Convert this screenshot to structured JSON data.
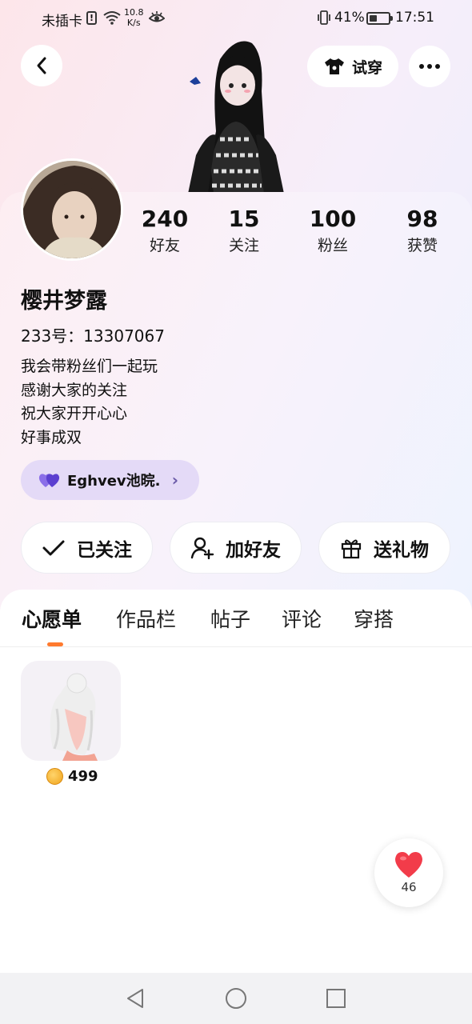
{
  "status_bar": {
    "carrier": "未插卡",
    "net_speed_value": "10.8",
    "net_speed_unit": "K/s",
    "battery_percent": "41%",
    "battery_level": 0.41,
    "time": "17:51"
  },
  "header": {
    "tryon_label": "试穿"
  },
  "stats": [
    {
      "value": "240",
      "label": "好友"
    },
    {
      "value": "15",
      "label": "关注"
    },
    {
      "value": "100",
      "label": "粉丝"
    },
    {
      "value": "98",
      "label": "获赞"
    }
  ],
  "profile": {
    "nickname": "樱井梦露",
    "id_line": "233号：13307067",
    "bio": [
      "我会带粉丝们一起玩",
      "感谢大家的关注",
      "祝大家开开心心",
      "好事成双"
    ],
    "fan_group": "Eghvev池晥."
  },
  "actions": {
    "followed": "已关注",
    "add_friend": "加好友",
    "send_gift": "送礼物"
  },
  "tabs": [
    "心愿单",
    "作品栏",
    "帖子",
    "评论",
    "穿搭"
  ],
  "active_tab": "心愿单",
  "wishlist": [
    {
      "price": "499"
    }
  ],
  "like_fab": {
    "count": "46"
  },
  "colors": {
    "accent": "#ff7a2e",
    "badge_bg": "#e4daf7",
    "heart": "#f23c4a",
    "fan_heart": "#6b4fd8"
  }
}
